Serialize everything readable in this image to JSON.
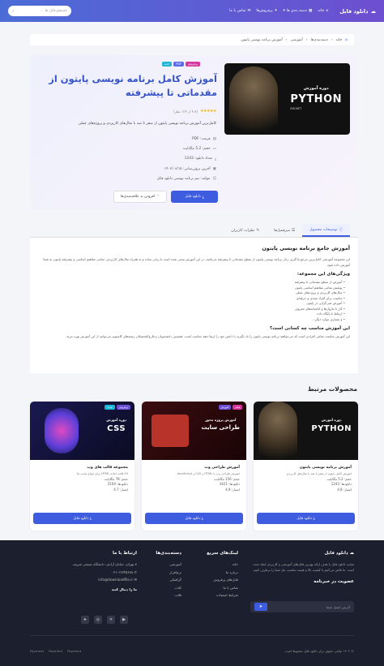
{
  "header": {
    "brand": "دانلود فایل",
    "nav": [
      "خانه",
      "دسته بندی ها",
      "پرفروش‌ها",
      "تماس با ما"
    ],
    "search_placeholder": "جستجو فایل ها ..."
  },
  "breadcrumb": [
    "خانه",
    "دسته‌بندی‌ها",
    "آموزشی",
    "آموزش برنامه نویسی پایتون"
  ],
  "product": {
    "badges": [
      "پرفروش",
      "PDF",
      "جدید"
    ],
    "title": "آموزش کامل برنامه نویسی پایتون از مقدماتی تا پیشرفته",
    "rating_text": "(۴.۸ از ۱۲۴ نظر)",
    "description": "کامل‌ترین آموزش برنامه نویسی پایتون از صفر تا صد با مثال‌های کاربردی و پروژه‌های عملی",
    "meta": [
      "فرمت: PDF",
      "حجم: 5.2 مگابایت",
      "تعداد دانلود: 1243",
      "آخرین بروزرسانی: ۱۴۰۲/۰۸/۱۵",
      "مولف: تیم برنامه نویسی دانلود فایل"
    ],
    "download_label": "دانلود فایل",
    "fav_label": "افزودن به علاقه‌مندی‌ها",
    "cover": {
      "small": "دوره آموزش",
      "big": "PYTHON",
      "brand": "ROCKET"
    }
  },
  "tabs": [
    "توضیحات محصول",
    "سرفصل‌ها",
    "نظرات کاربران"
  ],
  "content": {
    "h1": "آموزش جامع برنامه نویسی پایتون",
    "p1": "این مجموعه آموزشی کامل‌ترین مرجع یادگیری زبان برنامه نویسی پایتون از سطح مقدماتی تا پیشرفته می‌باشد. در این آموزش سعی شده است با زبانی ساده و به همراه مثال‌های کاربردی، تمامی مفاهیم اساسی و پیشرفته پایتون به شما آموزش داده شود.",
    "h2": "ویژگی‌های این مجموعه:",
    "features": [
      "آموزش از سطح مقدماتی تا پیشرفته",
      "پوشش تمامی مفاهیم اساسی پایتون",
      "مثال‌های کاربردی و پروژه‌های عملی",
      "مناسب برای افراد مبتدی و حرفه‌ای",
      "آموزش شی‌گرایی در پایتون",
      "کار با ماژول‌ها و کتابخانه‌های معروف",
      "ارتباط با پایگاه داده",
      "و بسیاری موارد دیگر..."
    ],
    "h3": "این آموزش مناسب چه کسانی است؟",
    "p2": "این آموزش مناسب تمامی افرادی است که می‌خواهند برنامه نویسی پایتون را یاد بگیرند یا دانش خود را ارتقا دهند مناسب است. همچنین دانشجویان و فارغ‌التحصیلان رشته‌های کامپیوتر می‌توانند از این آموزش بهره ببرند."
  },
  "related_title": "محصولات مرتبط",
  "cards": [
    {
      "title": "آموزش برنامه نویسی پایتون",
      "desc": "آموزش کامل پایتون از صفر تا صد با مثال‌های کاربردی",
      "size": "حجم: 5.2 مگابایت",
      "downloads": "دانلودها: 1243",
      "rating": "امتیاز: 4.8",
      "btn": "دانلود فایل",
      "cover_small": "دوره آموزش",
      "cover_big": "PYTHON"
    },
    {
      "title": "آموزش طراحی وب",
      "desc": "آموزش طراحی وب با HTML و CSS و JavaScript",
      "size": "حجم: 156 مگابایت",
      "downloads": "دانلودها: 3421",
      "rating": "امتیاز: 4.9",
      "btn": "دانلود فایل",
      "cover_small": "آموزش پروژه محور",
      "cover_big": "طراحی سایت",
      "badges": [
        "فیلم",
        "آموزش"
      ]
    },
    {
      "title": "مجموعه قالب های وب",
      "desc": "50 قالب آماده HTML برای انواع سایت ها",
      "size": "حجم: 78 مگابایت",
      "downloads": "دانلودها: 2104",
      "rating": "امتیاز: 4.7",
      "btn": "دانلود فایل",
      "cover_small": "دوره آموزش",
      "cover_big": "CSS",
      "badges": [
        "پرفروش",
        "جدید"
      ]
    }
  ],
  "footer": {
    "about_title": "دانلود فایل",
    "about_text": "سایت دانلود فایل با هدف ارائه بهترین فایل‌های آموزشی و کاربردی ایجاد شده است. ما تلاش می‌کنیم با کیفیت بالا و قیمت مناسب نیاز شما را برطرف کنیم.",
    "newsletter_title": "عضویت در خبرنامه",
    "email_placeholder": "آدرس ایمیل شما",
    "quick_title": "لینک‌های سریع",
    "quick": [
      "خانه",
      "درباره ما",
      "فایل‌های پرفروش",
      "تماس با ما",
      "شرایط استفاده"
    ],
    "cat_title": "دسته‌بندی‌ها",
    "cats": [
      "آموزشی",
      "نرم‌افزار",
      "گرافیکی",
      "کتاب",
      "قالب"
    ],
    "contact_title": "ارتباط با ما",
    "contact": [
      "تهران، خیابان آزادی، دانشگاه صنعتی شریف",
      "۰۲۱-۱۲۳۴۵۶۷۸",
      "info@downloadfile.ir"
    ],
    "follow": "ما را دنبال کنید",
    "copyright": "© ۱۴۰۲ تمامی حقوق برای دانلود فایل محفوظ است.",
    "payments": [
      "Payment",
      "Payment",
      "Payment"
    ]
  }
}
